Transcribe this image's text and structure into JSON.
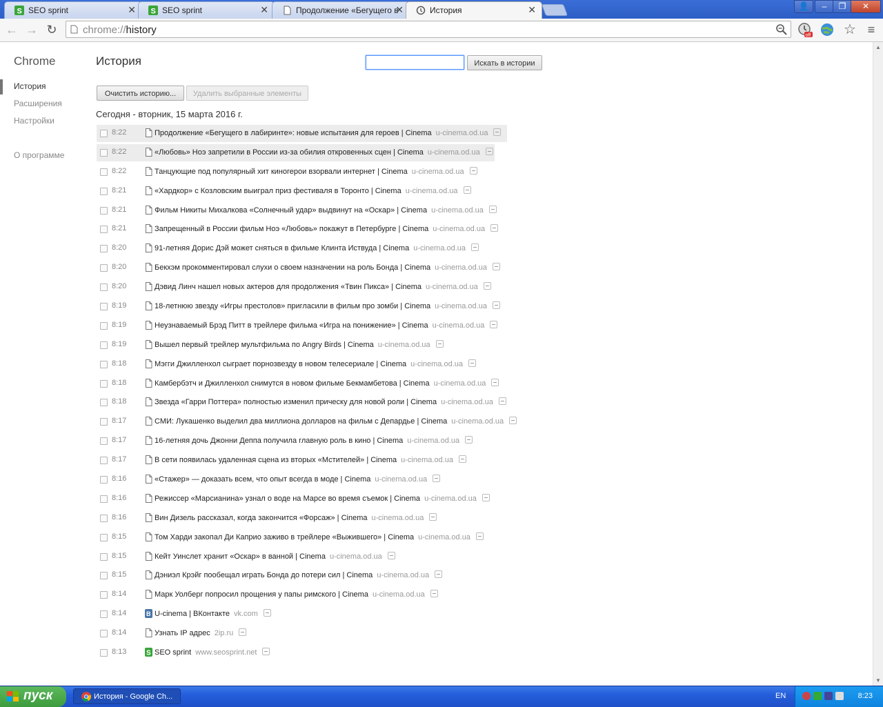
{
  "tabs": [
    {
      "title": "SEO sprint",
      "icon": "seosprint-favicon",
      "active": false
    },
    {
      "title": "SEO sprint",
      "icon": "seosprint-favicon",
      "active": false
    },
    {
      "title": "Продолжение «Бегущего в",
      "icon": "page-icon",
      "active": false
    },
    {
      "title": "История",
      "icon": "history-icon",
      "active": true
    }
  ],
  "omnibox": {
    "scheme": "chrome://",
    "path": "history"
  },
  "sidebar": {
    "brand": "Chrome",
    "items": [
      {
        "label": "История",
        "selected": true
      },
      {
        "label": "Расширения",
        "selected": false
      },
      {
        "label": "Настройки",
        "selected": false
      },
      {
        "label": "О программе",
        "selected": false
      }
    ]
  },
  "main": {
    "title": "История",
    "search_button": "Искать в истории",
    "search_value": "",
    "clear_button": "Очистить историю...",
    "delete_button": "Удалить выбранные элементы",
    "day_header": "Сегодня - вторник, 15 марта 2016 г."
  },
  "entries": [
    {
      "time": "8:22",
      "title": "Продолжение «Бегущего в лабиринте»: новые испытания для героев | Cinema",
      "domain": "u-cinema.od.ua",
      "icon": "page-icon"
    },
    {
      "time": "8:22",
      "title": "«Любовь» Ноэ запретили в России из-за обилия откровенных сцен | Cinema",
      "domain": "u-cinema.od.ua",
      "icon": "page-icon"
    },
    {
      "time": "8:22",
      "title": "Танцующие под популярный хит киногерои взорвали интернет | Cinema",
      "domain": "u-cinema.od.ua",
      "icon": "page-icon"
    },
    {
      "time": "8:21",
      "title": "«Хардкор» с Козловским выиграл приз фестиваля в Торонто | Cinema",
      "domain": "u-cinema.od.ua",
      "icon": "page-icon"
    },
    {
      "time": "8:21",
      "title": "Фильм Никиты Михалкова «Солнечный удар» выдвинут на «Оскар» | Cinema",
      "domain": "u-cinema.od.ua",
      "icon": "page-icon"
    },
    {
      "time": "8:21",
      "title": "Запрещенный в России фильм Ноэ «Любовь» покажут в Петербурге | Cinema",
      "domain": "u-cinema.od.ua",
      "icon": "page-icon"
    },
    {
      "time": "8:20",
      "title": "91-летняя Дорис Дэй может сняться в фильме Клинта Иствуда | Cinema",
      "domain": "u-cinema.od.ua",
      "icon": "page-icon"
    },
    {
      "time": "8:20",
      "title": "Бекхэм прокомментировал слухи о своем назначении на роль Бонда | Cinema",
      "domain": "u-cinema.od.ua",
      "icon": "page-icon"
    },
    {
      "time": "8:20",
      "title": "Дэвид Линч нашел новых актеров для продолжения «Твин Пикса» | Cinema",
      "domain": "u-cinema.od.ua",
      "icon": "page-icon"
    },
    {
      "time": "8:19",
      "title": "18-летнюю звезду «Игры престолов» пригласили в фильм про зомби | Cinema",
      "domain": "u-cinema.od.ua",
      "icon": "page-icon"
    },
    {
      "time": "8:19",
      "title": "Неузнаваемый Брэд Питт в трейлере фильма «Игра на понижение» | Cinema",
      "domain": "u-cinema.od.ua",
      "icon": "page-icon"
    },
    {
      "time": "8:19",
      "title": "Вышел первый трейлер мультфильма по Angry Birds | Cinema",
      "domain": "u-cinema.od.ua",
      "icon": "page-icon"
    },
    {
      "time": "8:18",
      "title": "Мэгги Джилленхол сыграет порнозвезду в новом телесериале | Cinema",
      "domain": "u-cinema.od.ua",
      "icon": "page-icon"
    },
    {
      "time": "8:18",
      "title": "Камбербэтч и Джилленхол снимутся в новом фильме Бекмамбетова | Cinema",
      "domain": "u-cinema.od.ua",
      "icon": "page-icon"
    },
    {
      "time": "8:18",
      "title": "Звезда «Гарри Поттера» полностью изменил прическу для новой роли | Cinema",
      "domain": "u-cinema.od.ua",
      "icon": "page-icon"
    },
    {
      "time": "8:17",
      "title": "СМИ: Лукашенко выделил два миллиона долларов на фильм с Депардье | Cinema",
      "domain": "u-cinema.od.ua",
      "icon": "page-icon"
    },
    {
      "time": "8:17",
      "title": "16-летняя дочь Джонни Деппа получила главную роль в кино | Cinema",
      "domain": "u-cinema.od.ua",
      "icon": "page-icon"
    },
    {
      "time": "8:17",
      "title": "В сети появилась удаленная сцена из вторых «Мстителей» | Cinema",
      "domain": "u-cinema.od.ua",
      "icon": "page-icon"
    },
    {
      "time": "8:16",
      "title": "«Стажер» — доказать всем, что опыт всегда в моде | Cinema",
      "domain": "u-cinema.od.ua",
      "icon": "page-icon"
    },
    {
      "time": "8:16",
      "title": "Режиссер «Марсианина» узнал о воде на Марсе во время съемок | Cinema",
      "domain": "u-cinema.od.ua",
      "icon": "page-icon"
    },
    {
      "time": "8:16",
      "title": "Вин Дизель рассказал, когда закончится «Форсаж» | Cinema",
      "domain": "u-cinema.od.ua",
      "icon": "page-icon"
    },
    {
      "time": "8:15",
      "title": "Том Харди закопал Ди Каприо заживо в трейлере «Выжившего» | Cinema",
      "domain": "u-cinema.od.ua",
      "icon": "page-icon"
    },
    {
      "time": "8:15",
      "title": "Кейт Уинслет хранит «Оскар» в ванной | Cinema",
      "domain": "u-cinema.od.ua",
      "icon": "page-icon"
    },
    {
      "time": "8:15",
      "title": "Дэниэл Крэйг пообещал играть Бонда до потери сил | Cinema",
      "domain": "u-cinema.od.ua",
      "icon": "page-icon"
    },
    {
      "time": "8:14",
      "title": "Марк Уолберг попросил прощения у папы римского | Cinema",
      "domain": "u-cinema.od.ua",
      "icon": "page-icon"
    },
    {
      "time": "8:14",
      "title": "U-cinema | ВКонтакте",
      "domain": "vk.com",
      "icon": "vk-icon"
    },
    {
      "time": "8:14",
      "title": "Узнать IP адрес",
      "domain": "2ip.ru",
      "icon": "page-icon"
    },
    {
      "time": "8:13",
      "title": "SEO sprint",
      "domain": "www.seosprint.net",
      "icon": "seosprint-favicon"
    }
  ],
  "taskbar": {
    "start_label": "пуск",
    "task_label": "История - Google Ch...",
    "language": "EN",
    "clock": "8:23"
  },
  "colors": {
    "accent": "#4d90fe",
    "taskbar": "#245edb",
    "start": "#3d9c3d"
  }
}
